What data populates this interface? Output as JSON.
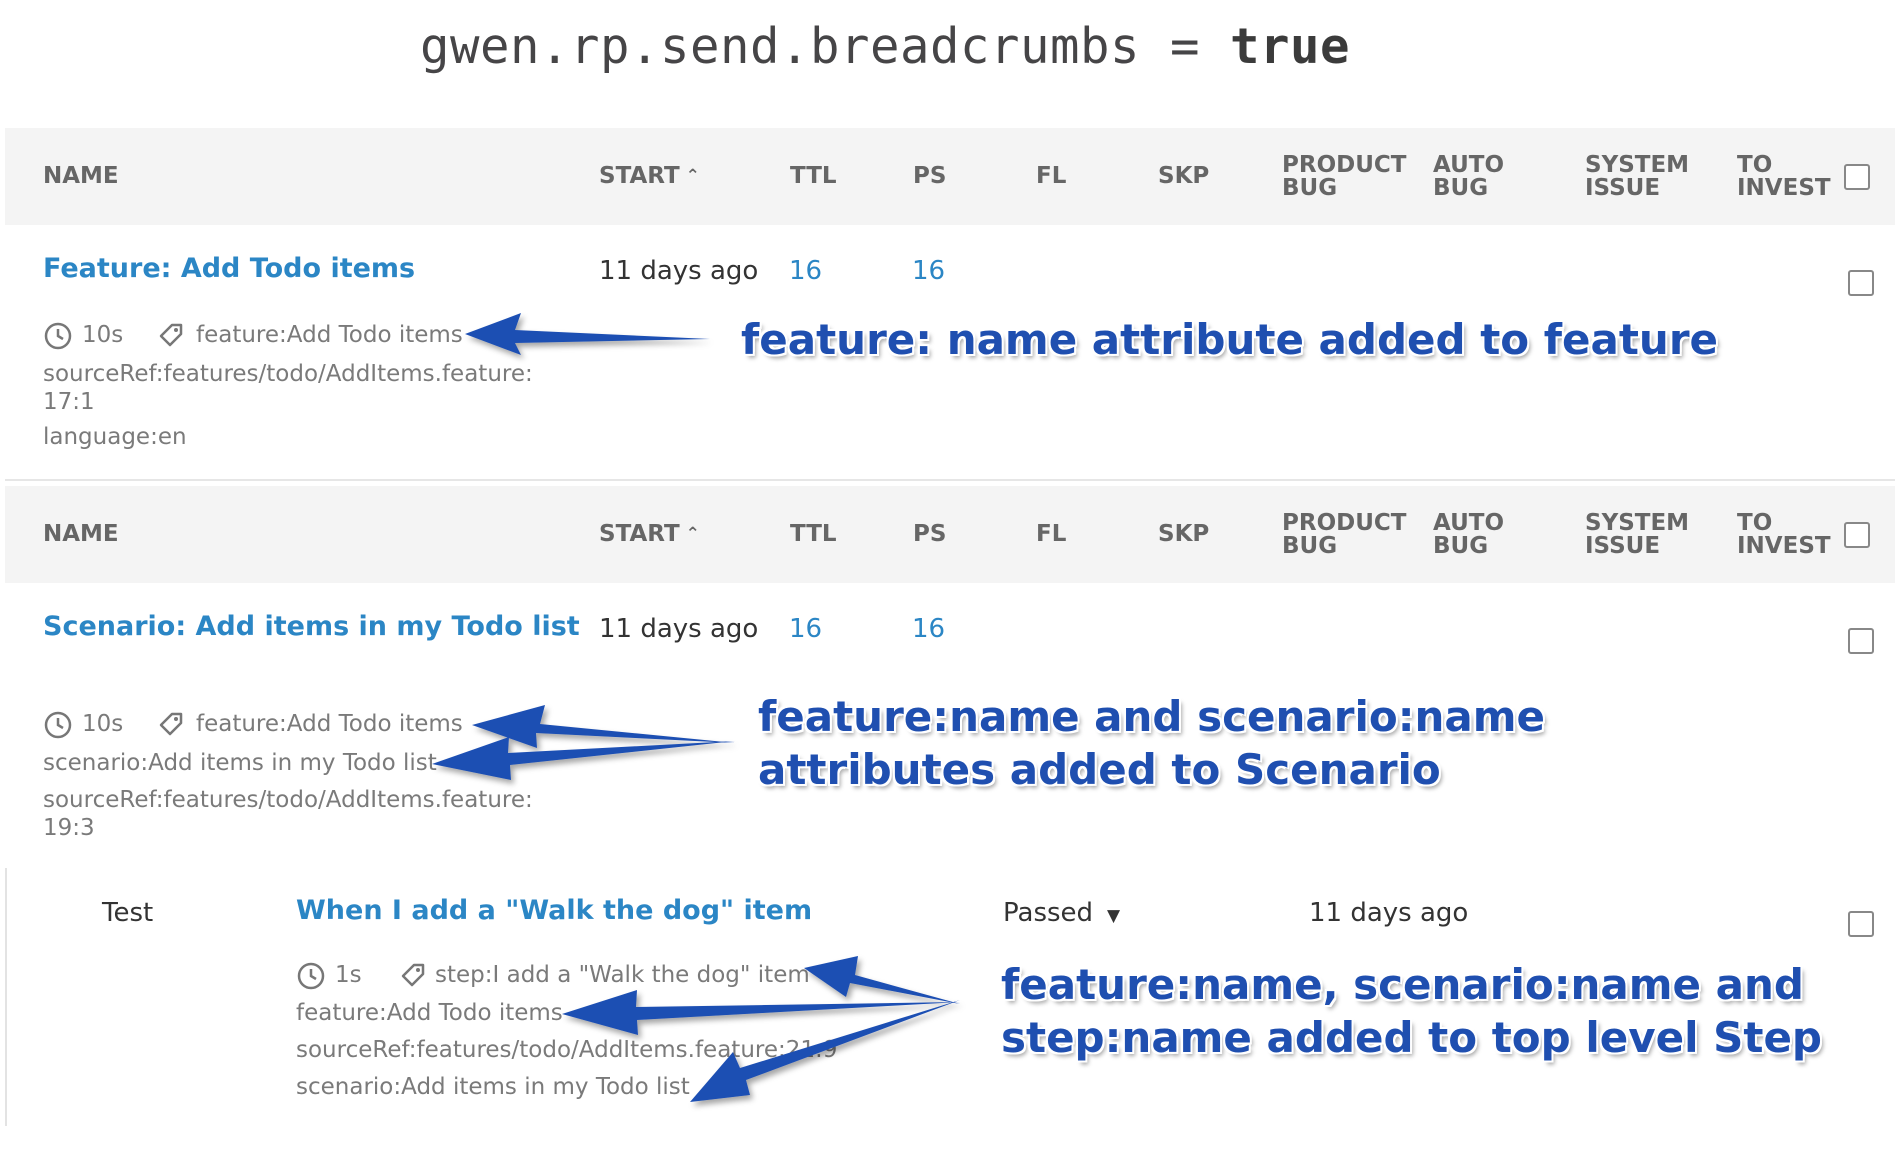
{
  "title": {
    "prefix": "gwen.rp.send.breadcrumbs = ",
    "keyword": "true"
  },
  "columns": {
    "name": "NAME",
    "start": "START",
    "ttl": "TTL",
    "ps": "PS",
    "fl": "FL",
    "skp": "SKP",
    "product_bug": "PRODUCT BUG",
    "auto_bug": "AUTO BUG",
    "system_issue": "SYSTEM ISSUE",
    "to_invest": "TO INVEST"
  },
  "feature_row": {
    "name": "Feature: Add Todo items",
    "start": "11 days ago",
    "ttl": "16",
    "ps": "16",
    "duration": "10s",
    "attr_feature": "feature:Add Todo items",
    "source_ref": "sourceRef:features/todo/AddItems.feature:17:1",
    "language": "language:en"
  },
  "scenario_row": {
    "name": "Scenario: Add items in my Todo list",
    "start": "11 days ago",
    "ttl": "16",
    "ps": "16",
    "duration": "10s",
    "attr_feature": "feature:Add Todo items",
    "attr_scenario": "scenario:Add items in my Todo list",
    "source_ref": "sourceRef:features/todo/AddItems.feature:19:3"
  },
  "step_row": {
    "type": "Test",
    "name": "When I add a \"Walk the dog\" item",
    "status": "Passed",
    "start": "11 days ago",
    "duration": "1s",
    "attr_step": "step:I add a \"Walk the dog\" item",
    "attr_feature": "feature:Add Todo items",
    "source_ref": "sourceRef:features/todo/AddItems.feature:21:9",
    "attr_scenario": "scenario:Add items in my Todo list"
  },
  "annotations": {
    "feature_note": "feature: name attribute added to feature",
    "scenario_note_1": "feature:name and scenario:name",
    "scenario_note_2": "attributes added to Scenario",
    "step_note_1": "feature:name, scenario:name and",
    "step_note_2": "step:name added to top level Step"
  },
  "colors": {
    "link": "#2b86c5",
    "annotation": "#1f4fb0",
    "header_bg": "#f4f4f4"
  }
}
